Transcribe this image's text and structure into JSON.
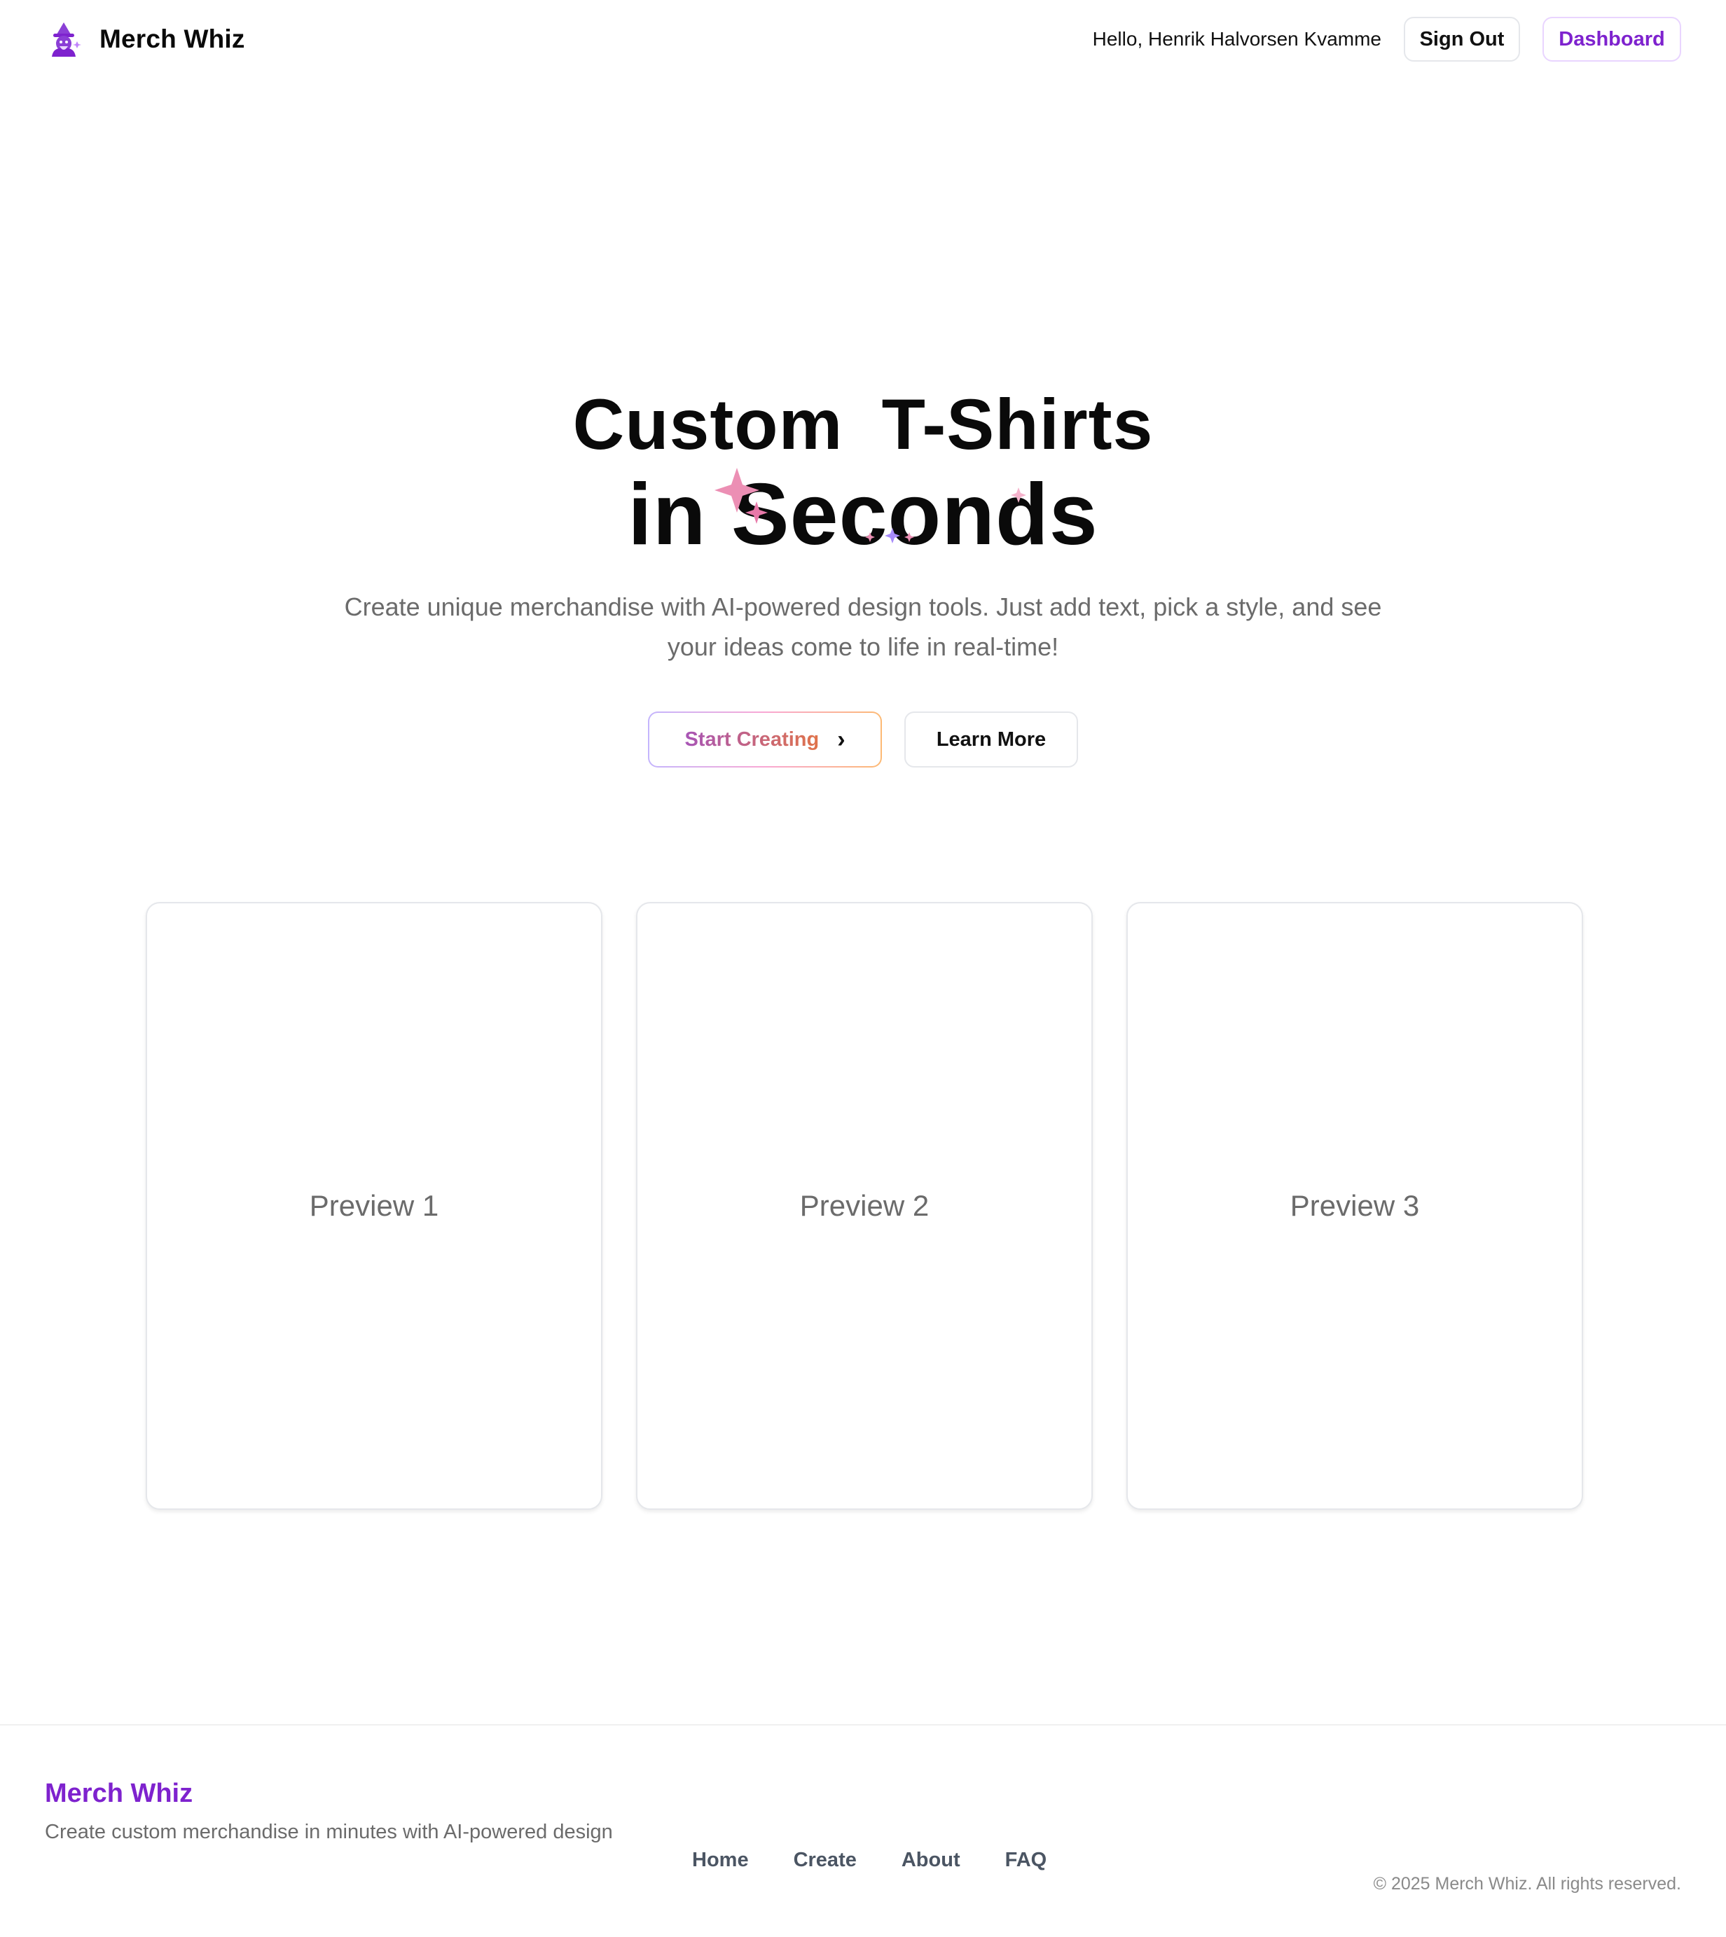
{
  "header": {
    "brand_name": "Merch Whiz",
    "greeting": "Hello, Henrik Halvorsen Kvamme",
    "sign_out_label": "Sign Out",
    "dashboard_label": "Dashboard",
    "logo_icon": "wizard-icon"
  },
  "hero": {
    "title_line1": "Custom  T-Shirts",
    "title_line2": "in Seconds",
    "subtitle_line1": "Create unique merchandise with AI-powered design tools. Just add text, pick a style, and see",
    "subtitle_line2": "your ideas come to life in real-time!",
    "start_label": "Start Creating",
    "learn_label": "Learn More"
  },
  "previews": [
    {
      "label": "Preview 1"
    },
    {
      "label": "Preview 2"
    },
    {
      "label": "Preview 3"
    }
  ],
  "footer": {
    "brand_name": "Merch Whiz",
    "tagline": "Create custom merchandise in minutes with AI-powered design",
    "nav": [
      {
        "label": "Home"
      },
      {
        "label": "Create"
      },
      {
        "label": "About"
      },
      {
        "label": "FAQ"
      }
    ],
    "copyright": "© 2025 Merch Whiz. All rights reserved."
  },
  "colors": {
    "brand_purple": "#7e22ce",
    "sparkle_pink": "#ec8fb4",
    "sparkle_purple": "#a78bfa"
  }
}
